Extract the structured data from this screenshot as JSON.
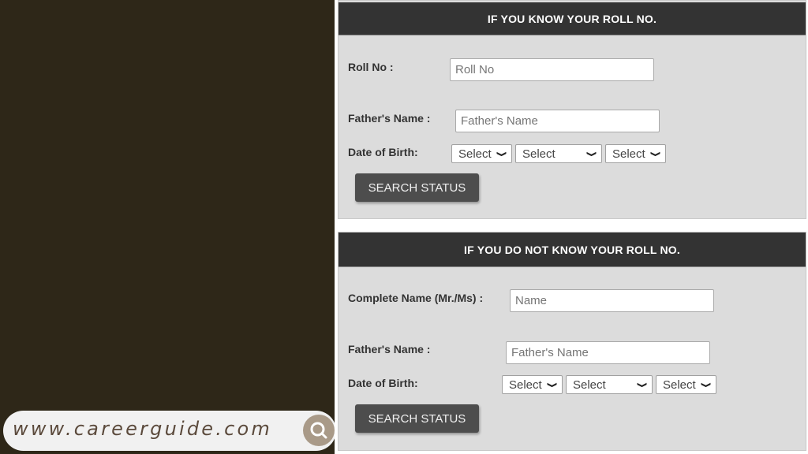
{
  "branding": {
    "url": "www.careerguide.com",
    "search_icon": "search-icon"
  },
  "section_known": {
    "title": "IF YOU KNOW YOUR ROLL NO.",
    "roll_label": "Roll No :",
    "roll_placeholder": "Roll No",
    "father_label": "Father's Name :",
    "father_placeholder": "Father's Name",
    "dob_label": "Date of Birth:",
    "dob_day": "Select",
    "dob_month": "Select",
    "dob_year": "Select",
    "button": "SEARCH STATUS"
  },
  "section_unknown": {
    "title": "IF YOU DO NOT KNOW YOUR ROLL NO.",
    "name_label": "Complete Name (Mr./Ms) :",
    "name_placeholder": "Name",
    "father_label": "Father's Name :",
    "father_placeholder": "Father's Name",
    "dob_label": "Date of Birth:",
    "dob_day": "Select",
    "dob_month": "Select",
    "dob_year": "Select",
    "button": "SEARCH STATUS"
  },
  "colors": {
    "left_bg": "#2e2718",
    "header_bg": "#333333",
    "section_bg": "#dcdcdc",
    "button_bg": "#4d4d4d",
    "brand_text": "#5b4a3c",
    "search_circle": "#a99a88"
  }
}
